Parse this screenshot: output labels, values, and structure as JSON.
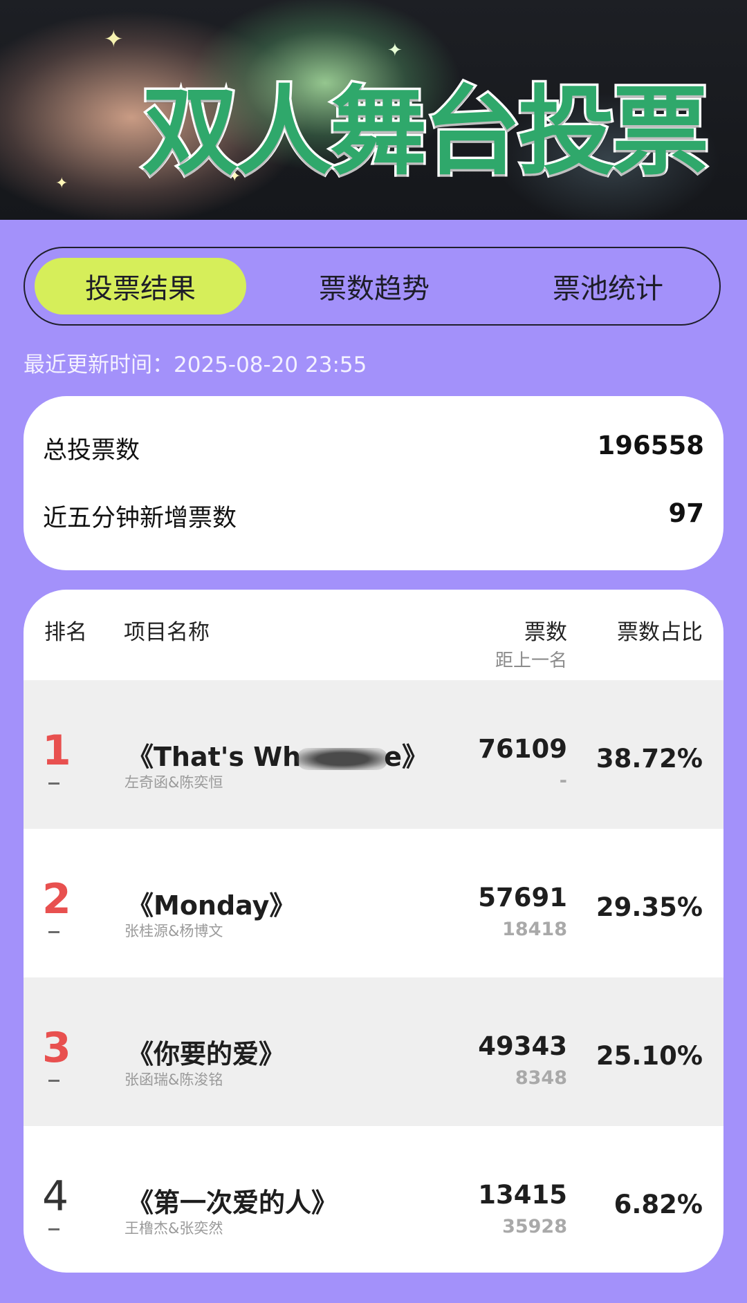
{
  "banner": {
    "title": "双人舞台投票"
  },
  "tabs": [
    {
      "label": "投票结果",
      "active": true
    },
    {
      "label": "票数趋势",
      "active": false
    },
    {
      "label": "票池统计",
      "active": false
    }
  ],
  "update_time": "最近更新时间：2025-08-20 23:55",
  "summary": {
    "total_label": "总投票数",
    "total_value": "196558",
    "recent_label": "近五分钟新增票数",
    "recent_value": "97"
  },
  "table": {
    "headers": {
      "rank": "排名",
      "name": "项目名称",
      "votes": "票数",
      "gap": "距上一名",
      "share": "票数占比"
    },
    "rows": [
      {
        "rank": "1",
        "title_prefix": "《That's Wh",
        "title_suffix": "e》",
        "artists": "左奇函&陈奕恒",
        "votes": "76109",
        "gap": "-",
        "share": "38.72%"
      },
      {
        "rank": "2",
        "title": "《Monday》",
        "artists": "张桂源&杨博文",
        "votes": "57691",
        "gap": "18418",
        "share": "29.35%"
      },
      {
        "rank": "3",
        "title": "《你要的爱》",
        "artists": "张函瑞&陈浚铭",
        "votes": "49343",
        "gap": "8348",
        "share": "25.10%"
      },
      {
        "rank": "4",
        "title": "《第一次爱的人》",
        "artists": "王橹杰&张奕然",
        "votes": "13415",
        "gap": "35928",
        "share": "6.82%"
      }
    ]
  }
}
